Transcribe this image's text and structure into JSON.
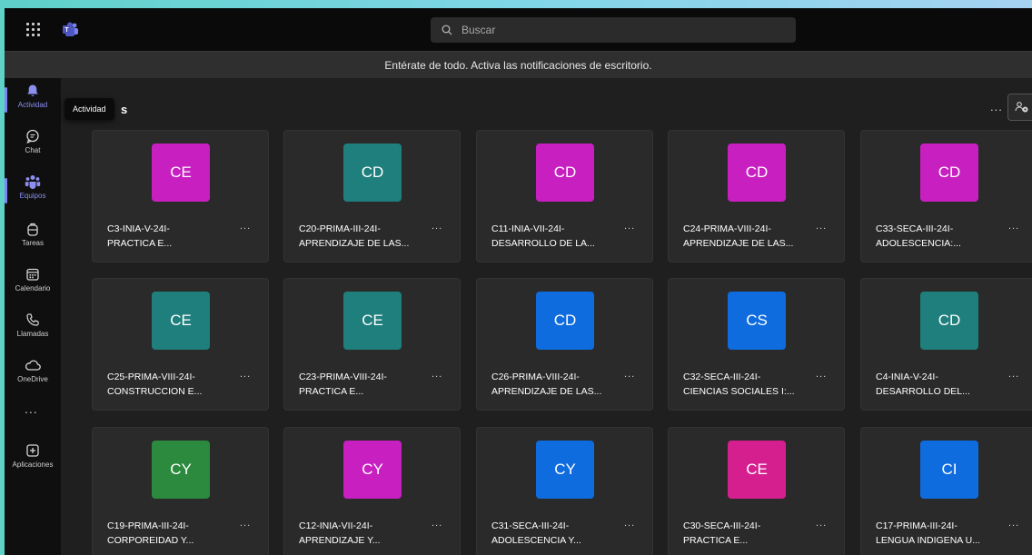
{
  "search": {
    "placeholder": "Buscar"
  },
  "notification": {
    "text": "Entérate de todo. Activa las notificaciones de escritorio."
  },
  "rail": {
    "items": [
      {
        "label": "Actividad",
        "icon": "bell-icon"
      },
      {
        "label": "Chat",
        "icon": "chat-icon"
      },
      {
        "label": "Equipos",
        "icon": "teams-icon"
      },
      {
        "label": "Tareas",
        "icon": "backpack-icon"
      },
      {
        "label": "Calendario",
        "icon": "calendar-icon"
      },
      {
        "label": "Llamadas",
        "icon": "phone-icon"
      },
      {
        "label": "OneDrive",
        "icon": "cloud-icon"
      },
      {
        "label": "Aplicaciones",
        "icon": "add-apps-icon"
      }
    ],
    "more": "..."
  },
  "header": {
    "tooltip": "Actividad",
    "fragment": "s",
    "more": "..."
  },
  "teams": [
    {
      "initials": "CE",
      "color": "#c81fc1",
      "line1": "C3-INIA-V-24I-",
      "line2": "PRACTICA E..."
    },
    {
      "initials": "CD",
      "color": "#1e7f7d",
      "line1": "C20-PRIMA-III-24I-",
      "line2": "APRENDIZAJE DE LAS..."
    },
    {
      "initials": "CD",
      "color": "#c81fc1",
      "line1": "C11-INIA-VII-24I-",
      "line2": "DESARROLLO DE LA..."
    },
    {
      "initials": "CD",
      "color": "#c81fc1",
      "line1": "C24-PRIMA-VIII-24I-",
      "line2": "APRENDIZAJE DE LAS..."
    },
    {
      "initials": "CD",
      "color": "#c81fc1",
      "line1": "C33-SECA-III-24I-",
      "line2": "ADOLESCENCIA:..."
    },
    {
      "initials": "CE",
      "color": "#1e7f7d",
      "line1": "C25-PRIMA-VIII-24I-",
      "line2": "CONSTRUCCION E..."
    },
    {
      "initials": "CE",
      "color": "#1e7f7d",
      "line1": "C23-PRIMA-VIII-24I-",
      "line2": "PRACTICA E..."
    },
    {
      "initials": "CD",
      "color": "#0f6cde",
      "line1": "C26-PRIMA-VIII-24I-",
      "line2": "APRENDIZAJE DE LAS..."
    },
    {
      "initials": "CS",
      "color": "#0f6cde",
      "line1": "C32-SECA-III-24I-",
      "line2": "CIENCIAS SOCIALES I:..."
    },
    {
      "initials": "CD",
      "color": "#1e7f7d",
      "line1": "C4-INIA-V-24I-",
      "line2": "DESARROLLO DEL..."
    },
    {
      "initials": "CY",
      "color": "#2c8a3e",
      "line1": "C19-PRIMA-III-24I-",
      "line2": "CORPOREIDAD Y..."
    },
    {
      "initials": "CY",
      "color": "#c81fc1",
      "line1": "C12-INIA-VII-24I-",
      "line2": "APRENDIZAJE Y..."
    },
    {
      "initials": "CY",
      "color": "#0f6cde",
      "line1": "C31-SECA-III-24I-",
      "line2": "ADOLESCENCIA Y..."
    },
    {
      "initials": "CE",
      "color": "#d61f8f",
      "line1": "C30-SECA-III-24I-",
      "line2": "PRACTICA E..."
    },
    {
      "initials": "CI",
      "color": "#0f6cde",
      "line1": "C17-PRIMA-III-24I-",
      "line2": "LENGUA INDIGENA U..."
    }
  ],
  "card_more": "..."
}
